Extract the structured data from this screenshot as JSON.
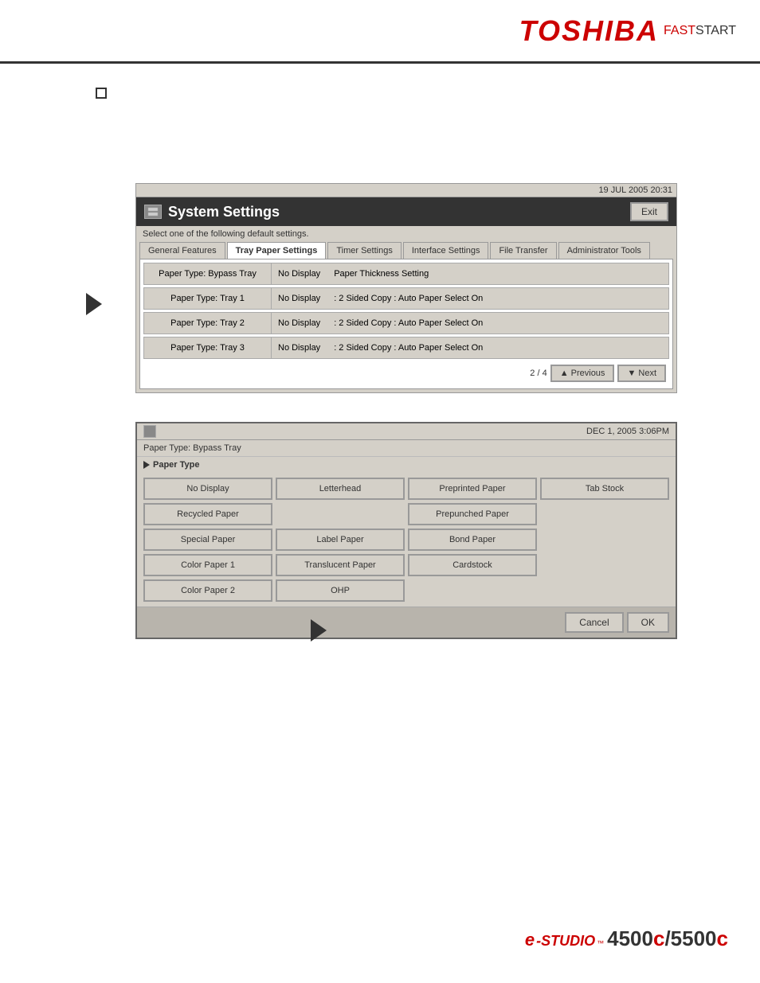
{
  "header": {
    "logo_toshiba": "TOSHIBA",
    "logo_fast": "FAST",
    "logo_start": "START",
    "divider": true
  },
  "checkbox_area": {
    "visible": true
  },
  "screen1": {
    "timestamp": "19 JUL  2005 20:31",
    "title": "System Settings",
    "exit_label": "Exit",
    "subtitle": "Select one of the following default settings.",
    "tabs": [
      {
        "label": "General Features",
        "active": false
      },
      {
        "label": "Tray Paper Settings",
        "active": true
      },
      {
        "label": "Timer Settings",
        "active": false
      },
      {
        "label": "Interface Settings",
        "active": false
      },
      {
        "label": "File Transfer",
        "active": false
      },
      {
        "label": "Administrator Tools",
        "active": false
      }
    ],
    "rows": [
      {
        "label": "Paper Type: Bypass Tray",
        "col1": "No Display",
        "col2": "Paper Thickness Setting"
      },
      {
        "label": "Paper Type: Tray 1",
        "col1": "No Display",
        "col2": ": 2 Sided Copy : Auto Paper Select On"
      },
      {
        "label": "Paper Type: Tray 2",
        "col1": "No Display",
        "col2": ": 2 Sided Copy : Auto Paper Select On"
      },
      {
        "label": "Paper Type: Tray 3",
        "col1": "No Display",
        "col2": ": 2 Sided Copy : Auto Paper Select On"
      }
    ],
    "pagination": "2 / 4",
    "prev_label": "▲ Previous",
    "next_label": "▼ Next"
  },
  "screen2": {
    "timestamp": "DEC  1, 2005  3:06PM",
    "breadcrumb": "Paper Type: Bypass Tray",
    "section_title": "Paper Type",
    "paper_buttons": [
      {
        "label": "No Display",
        "row": 1,
        "col": 1
      },
      {
        "label": "Letterhead",
        "row": 1,
        "col": 2
      },
      {
        "label": "Preprinted Paper",
        "row": 1,
        "col": 3
      },
      {
        "label": "Tab Stock",
        "row": 1,
        "col": 4
      },
      {
        "label": "Recycled Paper",
        "row": 2,
        "col": 1
      },
      {
        "label": "",
        "row": 2,
        "col": 2
      },
      {
        "label": "Prepunched Paper",
        "row": 2,
        "col": 3
      },
      {
        "label": "",
        "row": 2,
        "col": 4
      },
      {
        "label": "Special Paper",
        "row": 3,
        "col": 1
      },
      {
        "label": "Label Paper",
        "row": 3,
        "col": 2
      },
      {
        "label": "Bond Paper",
        "row": 3,
        "col": 3
      },
      {
        "label": "",
        "row": 3,
        "col": 4
      },
      {
        "label": "Color Paper 1",
        "row": 4,
        "col": 1
      },
      {
        "label": "Translucent Paper",
        "row": 4,
        "col": 2
      },
      {
        "label": "Cardstock",
        "row": 4,
        "col": 3
      },
      {
        "label": "",
        "row": 4,
        "col": 4
      },
      {
        "label": "Color Paper 2",
        "row": 5,
        "col": 1
      },
      {
        "label": "OHP",
        "row": 5,
        "col": 2
      },
      {
        "label": "",
        "row": 5,
        "col": 3
      },
      {
        "label": "",
        "row": 5,
        "col": 4
      }
    ],
    "cancel_label": "Cancel",
    "ok_label": "OK"
  },
  "footer": {
    "e_prefix": "e",
    "studio_text": "STUDIO",
    "tm": "™",
    "model": "4500c/5500c"
  }
}
